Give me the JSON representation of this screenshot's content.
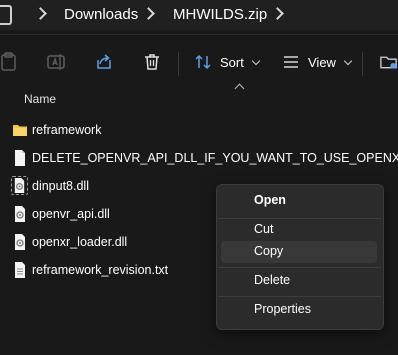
{
  "breadcrumb": {
    "items": [
      "Downloads",
      "MHWILDS.zip"
    ]
  },
  "toolbar": {
    "sort_label": "Sort",
    "view_label": "View"
  },
  "columns": {
    "name_header": "Name"
  },
  "files": [
    {
      "name": "reframework",
      "type": "folder"
    },
    {
      "name": "DELETE_OPENVR_API_DLL_IF_YOU_WANT_TO_USE_OPENXR",
      "type": "file"
    },
    {
      "name": "dinput8.dll",
      "type": "dll",
      "selected": true
    },
    {
      "name": "openvr_api.dll",
      "type": "dll"
    },
    {
      "name": "openxr_loader.dll",
      "type": "dll"
    },
    {
      "name": "reframework_revision.txt",
      "type": "text"
    }
  ],
  "context_menu": {
    "items": [
      "Open",
      "Cut",
      "Copy",
      "Delete",
      "Properties"
    ],
    "highlighted": "Copy"
  },
  "colors": {
    "background": "#191919",
    "menu_background": "#2b2b2b",
    "folder_yellow": "#f3c24d"
  }
}
